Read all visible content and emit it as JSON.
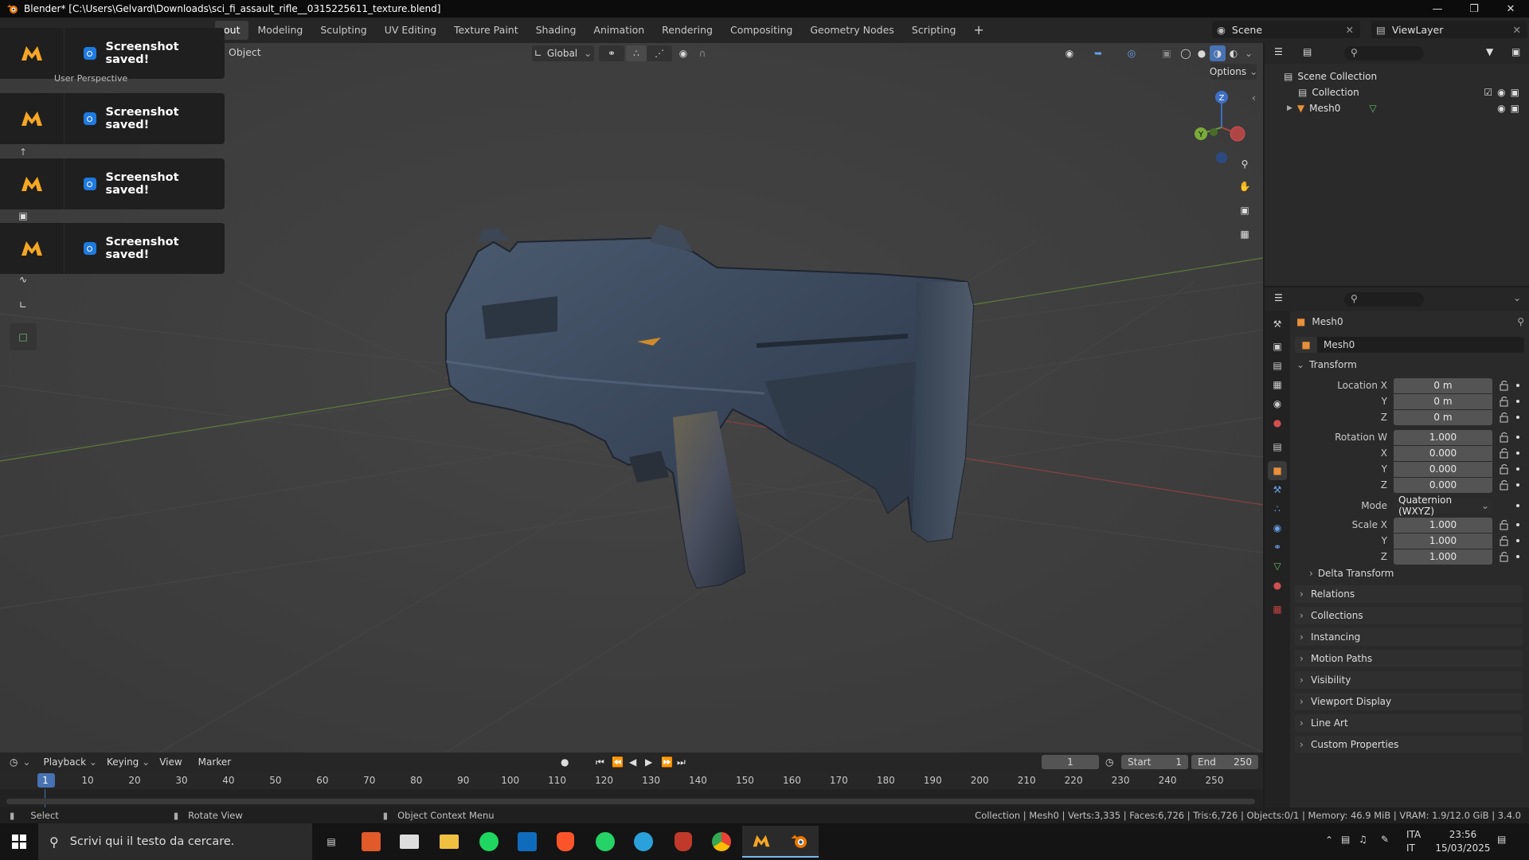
{
  "title": "Blender* [C:\\Users\\Gelvard\\Downloads\\sci_fi_assault_rifle__0315225611_texture.blend]",
  "workspaces": [
    "out",
    "Modeling",
    "Sculpting",
    "UV Editing",
    "Texture Paint",
    "Shading",
    "Animation",
    "Rendering",
    "Compositing",
    "Geometry Nodes",
    "Scripting",
    "+"
  ],
  "scene": "Scene",
  "view_layer": "ViewLayer",
  "viewport": {
    "mode_label": "Object",
    "orientation": "Global",
    "options": "Options",
    "hidden_header": "User Perspective",
    "gizmo": {
      "z": "Z",
      "y": "Y"
    }
  },
  "toasts": [
    "Screenshot saved!",
    "Screenshot saved!",
    "Screenshot saved!",
    "Screenshot saved!"
  ],
  "outliner": {
    "scene_collection": "Scene Collection",
    "collection": "Collection",
    "object": "Mesh0"
  },
  "properties": {
    "object_name": "Mesh0",
    "data_name": "Mesh0",
    "transform_header": "Transform",
    "location": {
      "label": "Location X",
      "x": "0 m",
      "y": "0 m",
      "z": "0 m"
    },
    "rotation": {
      "label": "Rotation W",
      "w": "1.000",
      "x": "0.000",
      "y": "0.000",
      "z": "0.000"
    },
    "mode": {
      "label": "Mode",
      "value": "Quaternion (WXYZ)"
    },
    "scale": {
      "label": "Scale X",
      "x": "1.000",
      "y": "1.000",
      "z": "1.000"
    },
    "axis_y": "Y",
    "axis_x": "X",
    "axis_z": "Z",
    "delta": "Delta Transform",
    "panels": [
      "Relations",
      "Collections",
      "Instancing",
      "Motion Paths",
      "Visibility",
      "Viewport Display",
      "Line Art",
      "Custom Properties"
    ]
  },
  "timeline": {
    "menus": [
      "Playback",
      "Keying",
      "View",
      "Marker"
    ],
    "current_frame": "1",
    "start_label": "Start",
    "start": "1",
    "end_label": "End",
    "end": "250",
    "ruler": [
      "1",
      "10",
      "20",
      "30",
      "40",
      "50",
      "60",
      "70",
      "80",
      "90",
      "100",
      "110",
      "120",
      "130",
      "140",
      "150",
      "160",
      "170",
      "180",
      "190",
      "200",
      "210",
      "220",
      "230",
      "240",
      "250"
    ]
  },
  "statusbar": {
    "select": "Select",
    "rotate": "Rotate View",
    "context": "Object Context Menu",
    "info": "Collection | Mesh0 | Verts:3,335 | Faces:6,726 | Tris:6,726 | Objects:0/1 | Memory: 46.9 MiB | VRAM: 1.9/12.0 GiB | 3.4.0"
  },
  "taskbar": {
    "search_placeholder": "Scrivi qui il testo da cercare.",
    "lang1": "ITA",
    "lang2": "IT",
    "time": "23:56",
    "date": "15/03/2025"
  },
  "colors": {
    "accent": "#4772b3",
    "blender_orange": "#ea7600",
    "toast_logo": "#f5a623",
    "x_axis": "#b04545",
    "y_axis": "#6a9a3a"
  }
}
